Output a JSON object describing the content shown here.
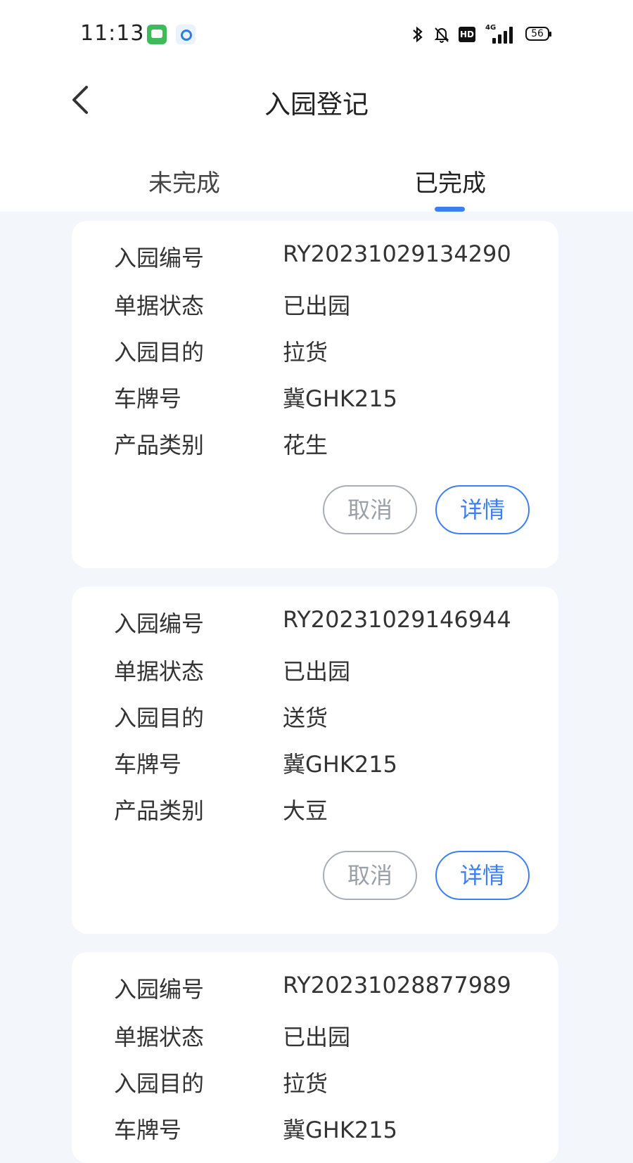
{
  "status_bar": {
    "time": "11:13",
    "network": "4G",
    "hd": "HD",
    "battery": "56",
    "icons": [
      "messages-app-icon",
      "qq-app-icon",
      "bluetooth-icon",
      "bell-off-icon",
      "hd-icon",
      "signal-icon",
      "battery-icon"
    ]
  },
  "header": {
    "title": "入园登记",
    "back_icon": "chevron-left-icon"
  },
  "tabs": [
    {
      "label": "未完成",
      "active": false
    },
    {
      "label": "已完成",
      "active": true
    }
  ],
  "colors": {
    "accent": "#3c7ff0",
    "page_background": "#f3f6fa",
    "card_background": "#ffffff",
    "cancel_border": "#a9adb5"
  },
  "records": [
    {
      "fields": [
        {
          "label": "入园编号",
          "value": "RY20231029134290"
        },
        {
          "label": "单据状态",
          "value": "已出园"
        },
        {
          "label": "入园目的",
          "value": "拉货"
        },
        {
          "label": "车牌号",
          "value": "冀GHK215"
        },
        {
          "label": "产品类别",
          "value": "花生"
        }
      ],
      "cancel_label": "取消",
      "detail_label": "详情"
    },
    {
      "fields": [
        {
          "label": "入园编号",
          "value": "RY20231029146944"
        },
        {
          "label": "单据状态",
          "value": "已出园"
        },
        {
          "label": "入园目的",
          "value": "送货"
        },
        {
          "label": "车牌号",
          "value": "冀GHK215"
        },
        {
          "label": "产品类别",
          "value": "大豆"
        }
      ],
      "cancel_label": "取消",
      "detail_label": "详情"
    },
    {
      "fields": [
        {
          "label": "入园编号",
          "value": "RY20231028877989"
        },
        {
          "label": "单据状态",
          "value": "已出园"
        },
        {
          "label": "入园目的",
          "value": "拉货"
        },
        {
          "label": "车牌号",
          "value": "冀GHK215"
        }
      ]
    }
  ]
}
